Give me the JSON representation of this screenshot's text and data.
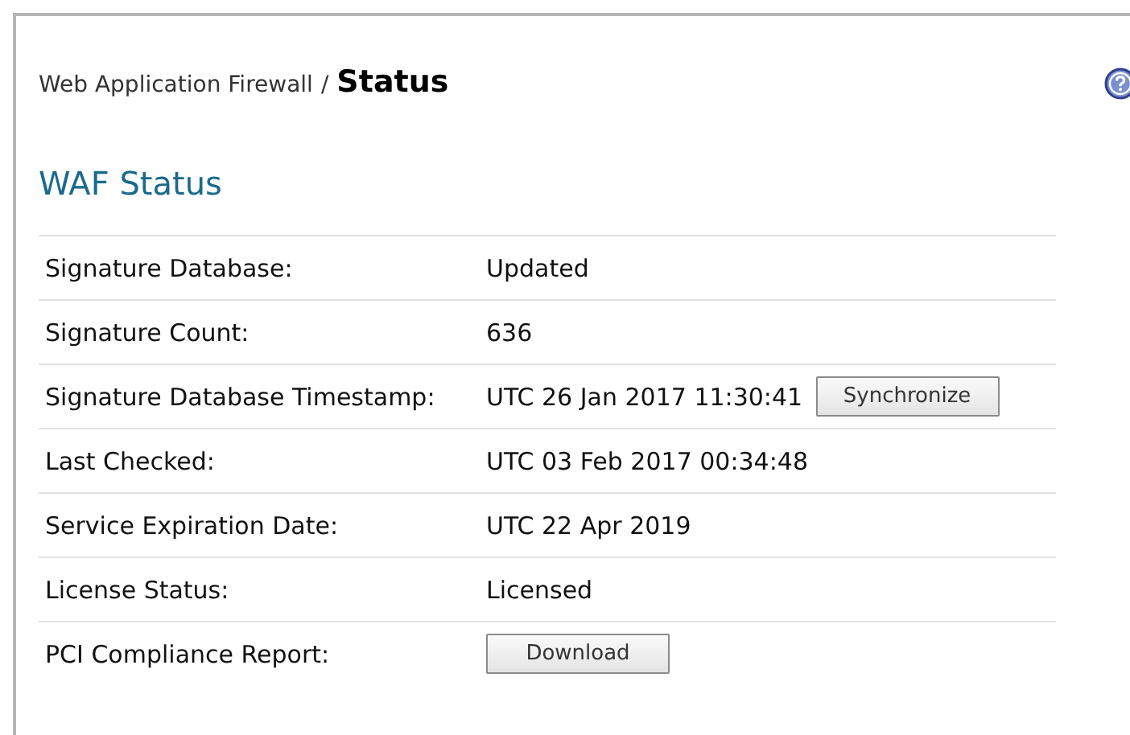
{
  "breadcrumb": {
    "parent": "Web Application Firewall",
    "separator": "/",
    "current": "Status"
  },
  "section_title": "WAF Status",
  "rows": [
    {
      "kind": "text",
      "label": "Signature Database:",
      "value": "Updated"
    },
    {
      "kind": "text",
      "label": "Signature Count:",
      "value": "636"
    },
    {
      "kind": "text_button",
      "label": "Signature Database Timestamp:",
      "value": "UTC 26 Jan 2017 11:30:41",
      "button": "Synchronize"
    },
    {
      "kind": "text",
      "label": "Last Checked:",
      "value": "UTC 03 Feb 2017 00:34:48"
    },
    {
      "kind": "text",
      "label": "Service Expiration Date:",
      "value": "UTC 22 Apr 2019"
    },
    {
      "kind": "text",
      "label": "License Status:",
      "value": "Licensed"
    },
    {
      "kind": "button",
      "label": "PCI Compliance Report:",
      "button": "Download"
    }
  ]
}
